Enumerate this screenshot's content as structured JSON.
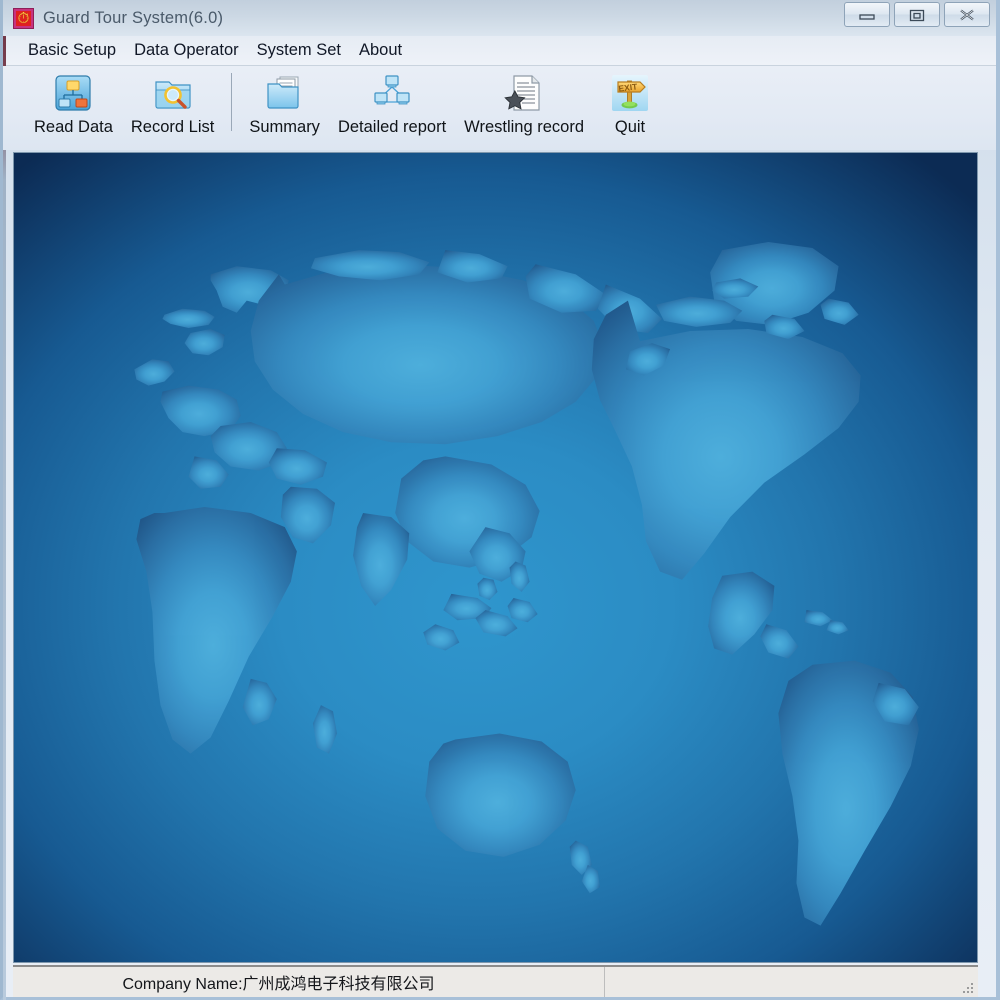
{
  "window": {
    "title": "Guard Tour System(6.0)",
    "app_icon": "clock-app-icon",
    "controls": [
      {
        "name": "minimize-button",
        "icon": "minimize-icon",
        "label": "Minimize"
      },
      {
        "name": "maximize-button",
        "icon": "restore-icon",
        "label": "Maximize"
      },
      {
        "name": "close-button",
        "icon": "close-icon",
        "label": "Close"
      }
    ]
  },
  "menu": {
    "items": [
      {
        "label": "Basic Setup"
      },
      {
        "label": "Data Operator"
      },
      {
        "label": "System Set"
      },
      {
        "label": "About"
      }
    ]
  },
  "toolbar": {
    "buttons": [
      {
        "label": "Read Data",
        "icon": "org-chart-icon"
      },
      {
        "label": "Record List",
        "icon": "folder-search-icon"
      },
      {
        "label": "Summary",
        "icon": "folder-documents-icon"
      },
      {
        "label": "Detailed report",
        "icon": "network-computers-icon"
      },
      {
        "label": "Wrestling record",
        "icon": "document-star-icon"
      },
      {
        "label": "Quit",
        "icon": "exit-sign-icon"
      }
    ],
    "separator_after_index": 1
  },
  "main": {
    "background_image": "world-map-blue",
    "colors": {
      "center": "#2b90c9",
      "edge": "#0d2a52",
      "land": "#3f9fd0",
      "land_dark": "#1f5e95"
    }
  },
  "status_bar": {
    "company_label": "Company Name:广州成鸿电子科技有限公司",
    "resize_grip": "resize-grip-icon"
  }
}
